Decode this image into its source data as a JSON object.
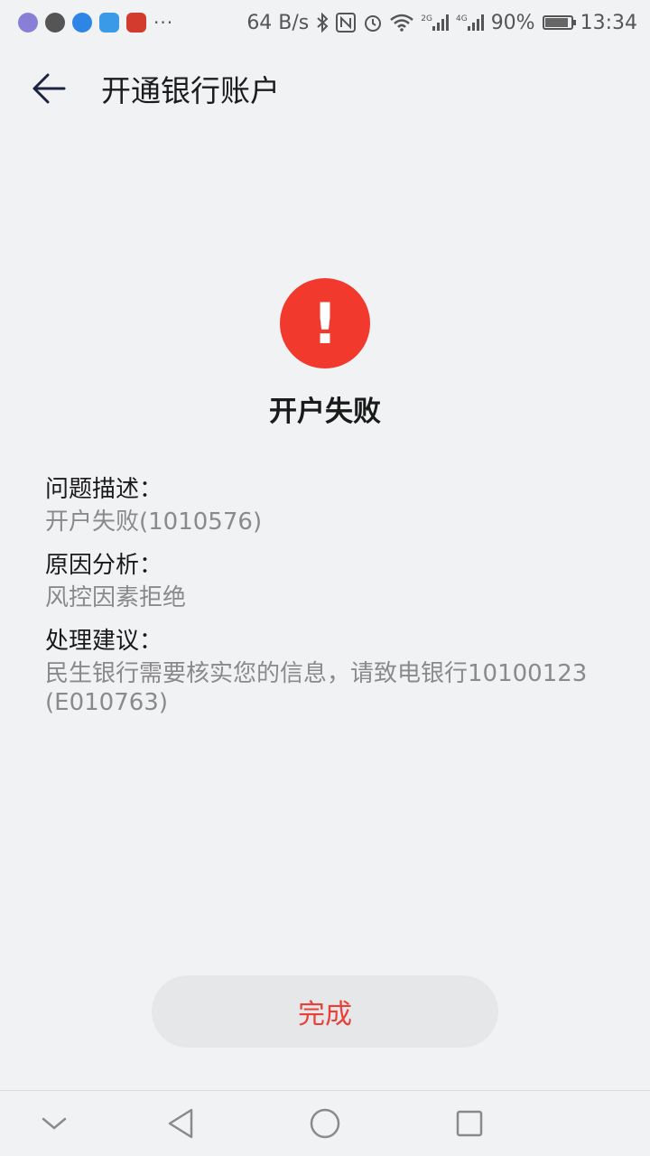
{
  "status_bar": {
    "net_speed": "64 B/s",
    "net_type_1": "2G",
    "net_type_2": "4G",
    "battery": "90%",
    "battery_level": 0.9,
    "time": "13:34",
    "more": "···",
    "icons": [
      "app-icon",
      "message-icon",
      "zhihu-app-icon",
      "app-icon",
      "app-icon",
      "bluetooth-icon",
      "nfc-icon",
      "alarm-icon",
      "wifi-icon",
      "signal-icon",
      "battery-icon"
    ]
  },
  "toolbar": {
    "title": "开通银行账户",
    "back_icon": "back-arrow-icon"
  },
  "result": {
    "icon": "!",
    "icon_color": "#f2392e",
    "title": "开户失败"
  },
  "details": {
    "problem_label": "问题描述：",
    "problem_value": "开户失败(1010576)",
    "reason_label": "原因分析：",
    "reason_value": "风控因素拒绝",
    "advice_label": "处理建议：",
    "advice_value": "民生银行需要核实您的信息，请致电银行10100123(E010763)"
  },
  "actions": {
    "done_label": "完成",
    "done_color": "#e9413a"
  },
  "nav_bar": {
    "icons": [
      "chevron-down-icon",
      "back-triangle-icon",
      "home-circle-icon",
      "recents-square-icon"
    ]
  }
}
